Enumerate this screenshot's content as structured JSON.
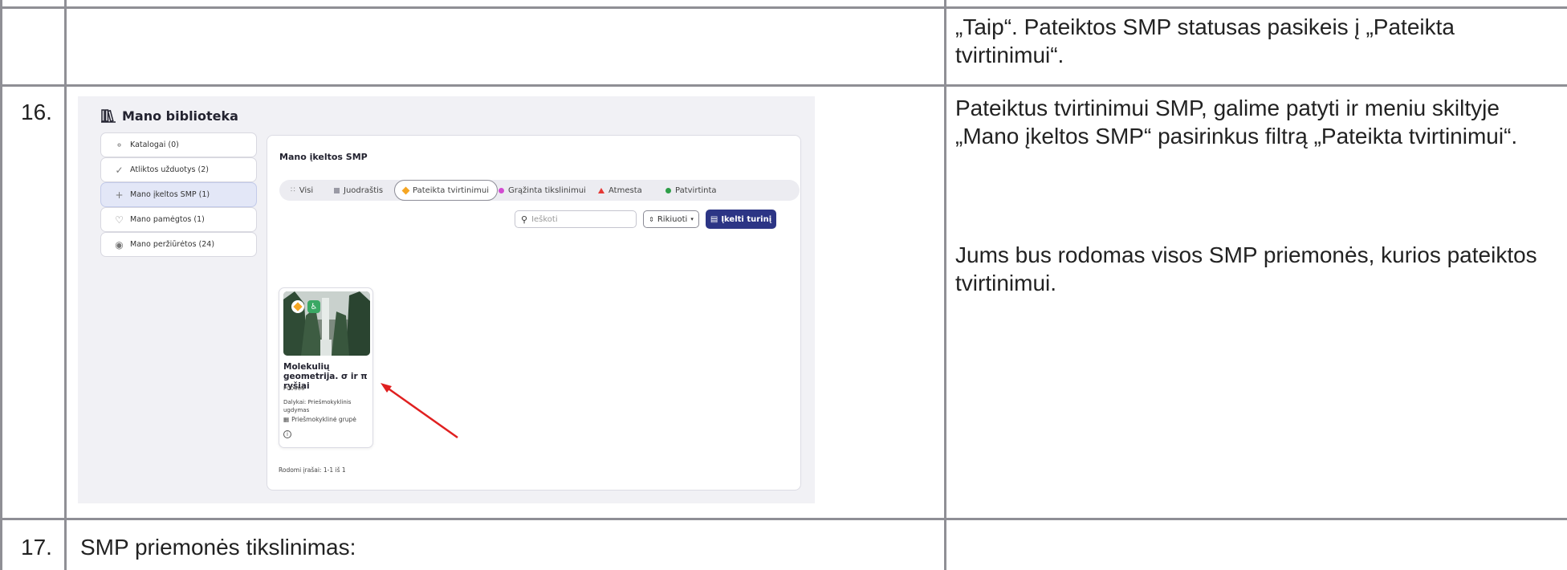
{
  "table": {
    "row15": {
      "description": "„Taip“. Pateiktos SMP statusas pasikeis į „Pateikta tvirtinimui“."
    },
    "row16": {
      "number": "16.",
      "description_1": "Pateiktus tvirtinimui SMP, galime patyti ir meniu skiltyje „Mano įkeltos SMP“ pasirinkus filtrą „Pateikta tvirtinimui“.",
      "description_2": "Jums bus rodomas visos SMP priemonės, kurios pateiktos tvirtinimui."
    },
    "row17": {
      "number": "17.",
      "title": "SMP priemonės tikslinimas:"
    }
  },
  "screenshot": {
    "library_title": "Mano biblioteka",
    "sidebar": {
      "items": [
        {
          "label": "Katalogai (0)",
          "icon": "catalog-icon",
          "active": false
        },
        {
          "label": "Atliktos užduotys (2)",
          "icon": "check-circle-icon",
          "active": false
        },
        {
          "label": "Mano įkeltos SMP (1)",
          "icon": "plus-icon",
          "active": true
        },
        {
          "label": "Mano pamėgtos (1)",
          "icon": "heart-icon",
          "active": false
        },
        {
          "label": "Mano peržiūrėtos (24)",
          "icon": "eye-icon",
          "active": false
        }
      ]
    },
    "panel_title": "Mano įkeltos SMP",
    "filters": [
      {
        "label": "Visi",
        "icon": "grid-icon",
        "color": "#888888"
      },
      {
        "label": "Juodraštis",
        "icon": "square-icon",
        "color": "#9a9aa5"
      },
      {
        "label": "Pateikta tvirtinimui",
        "icon": "diamond-icon",
        "color": "#f5a623",
        "active": true
      },
      {
        "label": "Grąžinta tikslinimui",
        "icon": "dot-icon",
        "color": "#d24bd1"
      },
      {
        "label": "Atmesta",
        "icon": "triangle-icon",
        "color": "#e53935"
      },
      {
        "label": "Patvirtinta",
        "icon": "dot-icon",
        "color": "#2e9e48"
      }
    ],
    "search_placeholder": "Ieškoti",
    "sort_label": "Rikiuoti",
    "upload_label": "Įkelti turinį",
    "card": {
      "title": "Molekulių geometrija. σ ir π ryšiai",
      "code": "P00006",
      "subject": "Dalykai: Priešmokyklinis ugdymas",
      "group": "Priešmokyklinė grupė"
    },
    "records": "Rodomi įrašai: 1-1 iš 1"
  }
}
